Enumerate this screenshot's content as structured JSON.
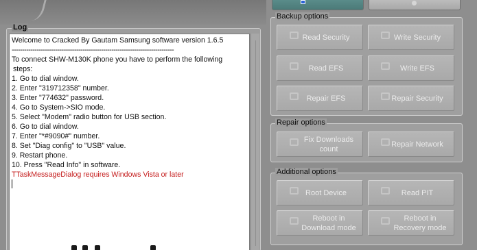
{
  "log": {
    "title": "Log",
    "lines": [
      "Welcome to Cracked By Gautam    Samsung software version 1.6.5",
      "------------------------------------------------------------------------------",
      "To connect SHW-M130K phone you have to perform the following",
      " steps:",
      "1. Go to dial window.",
      "2. Enter \"319712358\" number.",
      "3. Enter \"774632\" password.",
      "4. Go to System->SIO mode.",
      "5. Select \"Modem\" radio button for USB section.",
      "6. Go to dial window.",
      "7. Enter \"*#9090#\" number.",
      "8. Set \"Diag config\" to \"USB\" value.",
      "9. Restart phone.",
      "10. Press \"Read Info\" in software.",
      "TTaskMessageDialog requires Windows Vista or later"
    ],
    "error_color": "#c41a1a"
  },
  "backup": {
    "title": "Backup options",
    "read_security": "Read Security",
    "write_security": "Write Security",
    "read_efs": "Read EFS",
    "write_efs": "Write EFS",
    "repair_efs": "Repair EFS",
    "repair_security": "Repair Security"
  },
  "repair": {
    "title": "Repair options",
    "fix_downloads_1": "Fix Downloads",
    "fix_downloads_2": "count",
    "repair_network": "Repair Network"
  },
  "additional": {
    "title": "Additional options",
    "root_device": "Root Device",
    "read_pit": "Read PIT",
    "reboot_download_1": "Reboot in",
    "reboot_download_2": "Download mode",
    "reboot_recovery_1": "Reboot in",
    "reboot_recovery_2": "Recovery mode"
  },
  "colors": {
    "accent": "#4b7a78",
    "selection": "#2a62d6",
    "background": "#8e8e8e"
  }
}
